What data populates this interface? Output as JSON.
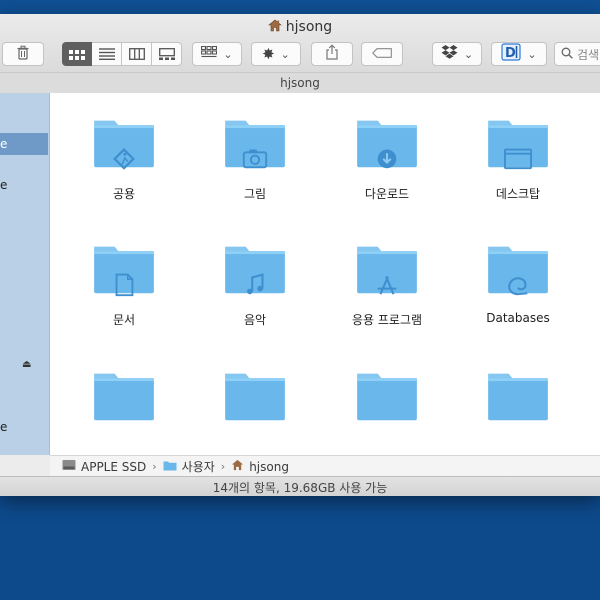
{
  "window": {
    "title": "hjsong",
    "path_title": "hjsong"
  },
  "toolbar": {
    "search_placeholder": "검색"
  },
  "sidebar": {
    "items": [
      {
        "label": "e",
        "selected": true
      },
      {
        "label": "e",
        "selected": false
      },
      {
        "label": "e",
        "selected": false
      }
    ]
  },
  "folders": [
    {
      "label": "공용",
      "icon": "public-walk-icon"
    },
    {
      "label": "그림",
      "icon": "camera-icon"
    },
    {
      "label": "다운로드",
      "icon": "download-icon"
    },
    {
      "label": "데스크탑",
      "icon": "desktop-window-icon"
    },
    {
      "label": "문서",
      "icon": "document-icon"
    },
    {
      "label": "음악",
      "icon": "music-note-icon"
    },
    {
      "label": "응용 프로그램",
      "icon": "app-store-icon"
    },
    {
      "label": "Databases",
      "icon": "shell-icon"
    },
    {
      "label": "",
      "icon": "folder-icon"
    },
    {
      "label": "",
      "icon": "folder-icon"
    },
    {
      "label": "",
      "icon": "folder-icon"
    },
    {
      "label": "",
      "icon": "folder-icon"
    }
  ],
  "breadcrumb": {
    "items": [
      "APPLE SSD",
      "사용자",
      "hjsong"
    ]
  },
  "status": {
    "text": "14개의 항목, 19.68GB 사용 가능"
  },
  "colors": {
    "desktop": "#0d4a8c",
    "folder": "#6ab7ec",
    "folder_tab": "#86c7f1",
    "sidebar": "#b9d0e6",
    "sidebar_selected": "#6f99c6"
  }
}
